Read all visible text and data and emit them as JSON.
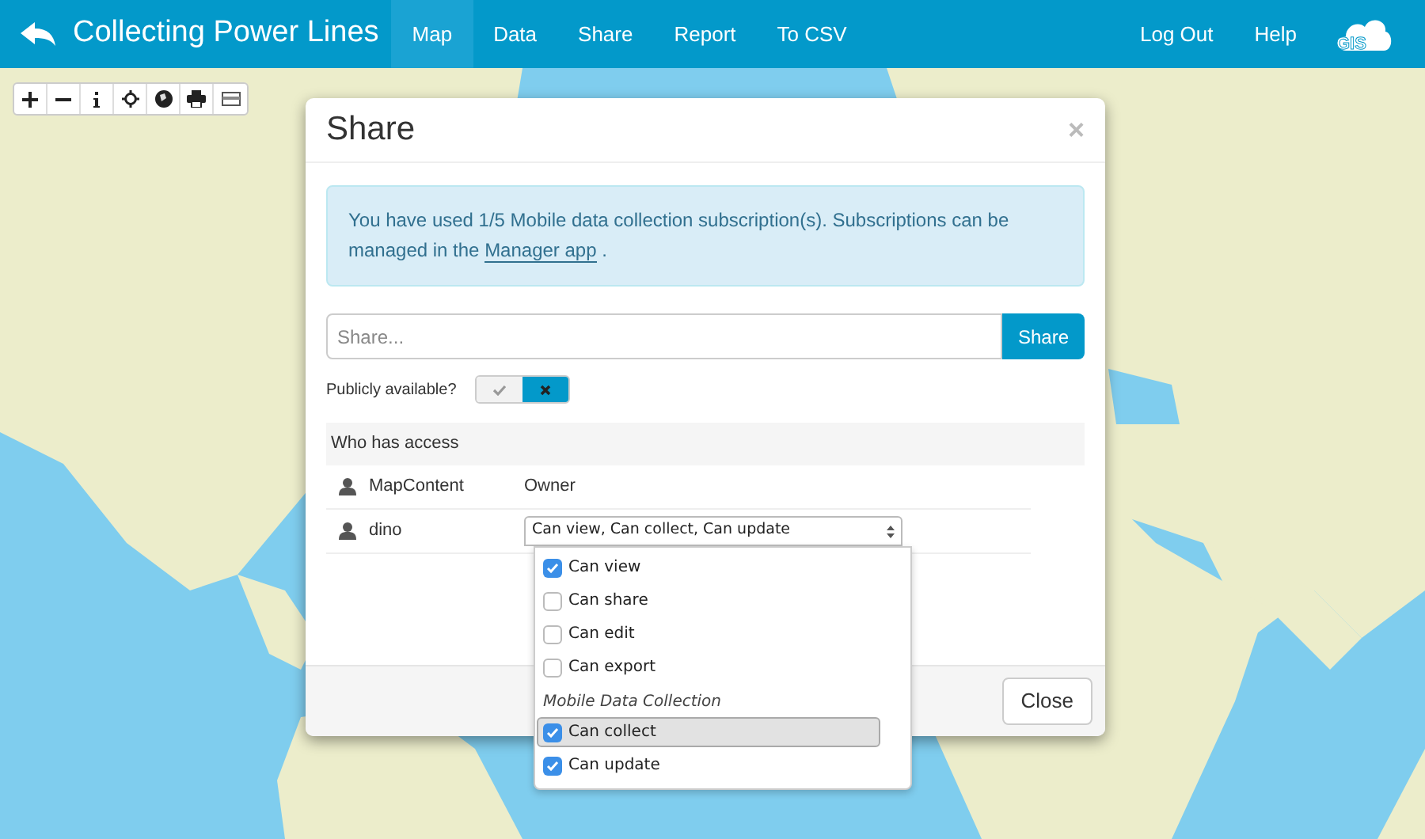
{
  "header": {
    "title": "Collecting Power Lines",
    "nav": [
      {
        "label": "Map",
        "selected": true
      },
      {
        "label": "Data",
        "selected": false
      },
      {
        "label": "Share",
        "selected": false
      },
      {
        "label": "Report",
        "selected": false
      },
      {
        "label": "To CSV",
        "selected": false
      }
    ],
    "right_links": [
      "Log Out",
      "Help"
    ],
    "logo_text": "GIS"
  },
  "dialog": {
    "title": "Share",
    "close_symbol": "×",
    "notice": {
      "text": "You have used 1/5 Mobile data collection subscription(s). Subscriptions can be managed in the ",
      "link": "Manager app",
      "end": " ."
    },
    "share_field": {
      "placeholder": "Share..."
    },
    "share_button": "Share",
    "public": {
      "label": "Publicly available?",
      "on": false
    },
    "access": {
      "heading": "Who has access",
      "rows": [
        {
          "user": "MapContent",
          "kind": "text",
          "role": "Owner"
        },
        {
          "user": "dino",
          "kind": "select",
          "role": "Can view, Can collect, Can update",
          "open": true
        }
      ]
    },
    "permission_menu": [
      {
        "kind": "option",
        "label": "Can view",
        "checked": true,
        "highlighted": false
      },
      {
        "kind": "option",
        "label": "Can share",
        "checked": false,
        "highlighted": false
      },
      {
        "kind": "option",
        "label": "Can edit",
        "checked": false,
        "highlighted": false
      },
      {
        "kind": "option",
        "label": "Can export",
        "checked": false,
        "highlighted": false
      },
      {
        "kind": "group",
        "label": "Mobile Data Collection"
      },
      {
        "kind": "option",
        "label": "Can collect",
        "checked": true,
        "highlighted": true
      },
      {
        "kind": "option",
        "label": "Can update",
        "checked": true,
        "highlighted": false
      }
    ],
    "close_button": "Close"
  }
}
